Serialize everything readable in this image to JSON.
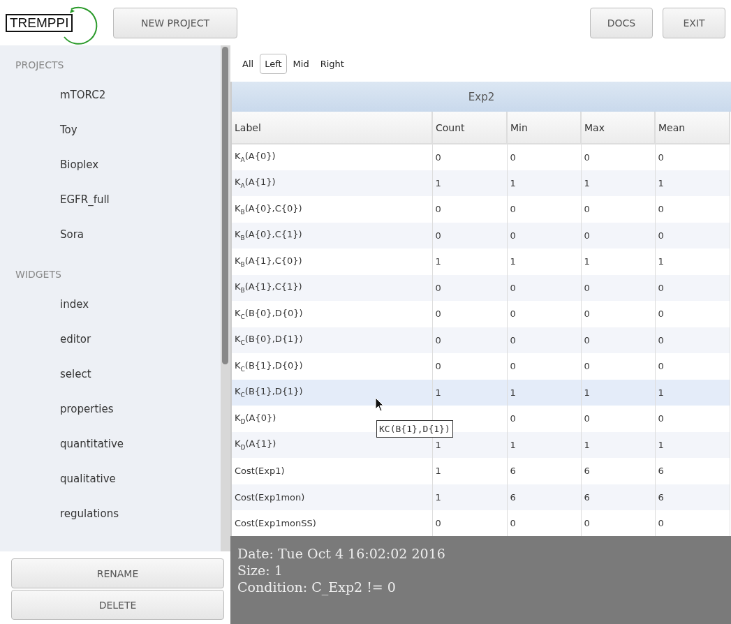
{
  "header": {
    "logo": "TREMPPI",
    "buttons_left": [
      "NEW PROJECT"
    ],
    "buttons_right": [
      "DOCS",
      "EXIT"
    ]
  },
  "sidebar": {
    "sections": [
      {
        "title": "PROJECTS",
        "items": [
          "mTORC2",
          "Toy",
          "Bioplex",
          "EGFR_full",
          "Sora"
        ]
      },
      {
        "title": "WIDGETS",
        "items": [
          "index",
          "editor",
          "select",
          "properties",
          "quantitative",
          "qualitative",
          "regulations"
        ]
      }
    ],
    "buttons": [
      "RENAME",
      "DELETE"
    ]
  },
  "filter_tabs": [
    {
      "label": "All",
      "selected": false
    },
    {
      "label": "Left",
      "selected": true
    },
    {
      "label": "Mid",
      "selected": false
    },
    {
      "label": "Right",
      "selected": false
    }
  ],
  "table": {
    "title": "Exp2",
    "columns": [
      "Label",
      "Count",
      "Min",
      "Max",
      "Mean"
    ],
    "rows": [
      {
        "cells": [
          "K$_{A}$(A{0})",
          "0",
          "0",
          "0",
          "0"
        ],
        "highlighted": false
      },
      {
        "cells": [
          "K$_{A}$(A{1})",
          "1",
          "1",
          "1",
          "1"
        ],
        "highlighted": false
      },
      {
        "cells": [
          "K$_{B}$(A{0},C{0})",
          "0",
          "0",
          "0",
          "0"
        ],
        "highlighted": false
      },
      {
        "cells": [
          "K$_{B}$(A{0},C{1})",
          "0",
          "0",
          "0",
          "0"
        ],
        "highlighted": false
      },
      {
        "cells": [
          "K$_{B}$(A{1},C{0})",
          "1",
          "1",
          "1",
          "1"
        ],
        "highlighted": false
      },
      {
        "cells": [
          "K$_{B}$(A{1},C{1})",
          "0",
          "0",
          "0",
          "0"
        ],
        "highlighted": false
      },
      {
        "cells": [
          "K$_{C}$(B{0},D{0})",
          "0",
          "0",
          "0",
          "0"
        ],
        "highlighted": false
      },
      {
        "cells": [
          "K$_{C}$(B{0},D{1})",
          "0",
          "0",
          "0",
          "0"
        ],
        "highlighted": false
      },
      {
        "cells": [
          "K$_{C}$(B{1},D{0})",
          "0",
          "0",
          "0",
          "0"
        ],
        "highlighted": false
      },
      {
        "cells": [
          "K$_{C}$(B{1},D{1})",
          "1",
          "1",
          "1",
          "1"
        ],
        "highlighted": true
      },
      {
        "cells": [
          "K$_{D}$(A{0})",
          "",
          "0",
          "0",
          "0"
        ],
        "highlighted": false
      },
      {
        "cells": [
          "K$_{D}$(A{1})",
          "1",
          "1",
          "1",
          "1"
        ],
        "highlighted": false
      },
      {
        "cells": [
          "Cost(Exp1)",
          "1",
          "6",
          "6",
          "6"
        ],
        "highlighted": false
      },
      {
        "cells": [
          "Cost(Exp1mon)",
          "1",
          "6",
          "6",
          "6"
        ],
        "highlighted": false
      },
      {
        "cells": [
          "Cost(Exp1monSS)",
          "0",
          "0",
          "0",
          "0"
        ],
        "highlighted": false
      }
    ],
    "tooltip": "KC(B{1},D{1})"
  },
  "info_panel": {
    "lines": [
      "Date: Tue Oct 4 16:02:02 2016",
      "Size: 1",
      "Condition: C_Exp2 != 0"
    ]
  }
}
